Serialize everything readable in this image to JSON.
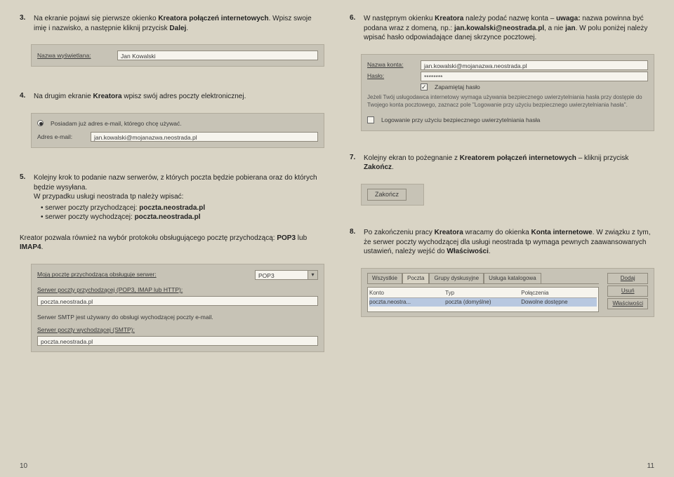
{
  "left": {
    "step3": {
      "num": "3.",
      "text_a": "Na ekranie pojawi się pierwsze okienko ",
      "bold_a": "Kreatora połączeń internetowych",
      "text_b": ". Wpisz swoje imię i nazwisko, a następnie kliknij przycisk ",
      "bold_b": "Dalej",
      "text_c": ".",
      "ss": {
        "lbl": "Nazwa wyświetlana:",
        "val": "Jan Kowalski"
      }
    },
    "step4": {
      "num": "4.",
      "text_a": "Na drugim ekranie ",
      "bold_a": "Kreatora",
      "text_b": " wpisz swój adres poczty elektronicznej.",
      "ss": {
        "radio": "Posiadam już adres e-mail, którego chcę używać.",
        "lbl": "Adres e-mail:",
        "val": "jan.kowalski@mojanazwa.neostrada.pl"
      }
    },
    "step5": {
      "num": "5.",
      "text_a": "Kolejny krok to podanie nazw serwerów, z których poczta będzie pobierana oraz do których będzie wysyłana.",
      "text_b": "W przypadku usługi neostrada tp należy wpisać:",
      "b1": "serwer poczty przychodzącej: ",
      "b1v": "poczta.neostrada.pl",
      "b2": "serwer poczty wychodzącej: ",
      "b2v": "poczta.neostrada.pl",
      "note_a": "Kreator pozwala również na wybór protokołu obsługującego pocztę przychodzącą: ",
      "note_b": "POP3",
      "note_c": " lub ",
      "note_d": "IMAP4",
      "note_e": ".",
      "ss": {
        "l1": "Moją pocztę przychodzącą obsługuje serwer:",
        "sel": "POP3",
        "l2": "Serwer poczty przychodzącej (POP3, IMAP lub HTTP):",
        "v2": "poczta.neostrada.pl",
        "l3": "Serwer SMTP jest używany do obsługi wychodzącej poczty e-mail.",
        "l4": "Serwer poczty wychodzącej (SMTP):",
        "v4": "poczta.neostrada.pl"
      }
    }
  },
  "right": {
    "step6": {
      "num": "6.",
      "text_a": "W następnym okienku ",
      "bold_a": "Kreatora",
      "text_b": " należy podać nazwę konta – ",
      "bold_uw": "uwaga:",
      "text_c": " nazwa powinna być podana wraz z domeną, np.: ",
      "bold_b": "jan.kowalski@neostrada.pl",
      "text_d": ", a nie ",
      "bold_c": "jan",
      "text_e": ". W polu poniżej należy wpisać hasło odpowiadające danej skrzynce pocztowej.",
      "ss": {
        "l1": "Nazwa konta:",
        "v1": "jan.kowalski@mojanazwa.neostrada.pl",
        "l2": "Hasło:",
        "v2": "********",
        "chk": "Zapamiętaj hasło",
        "note": "Jeżeli Twój usługodawca internetowy wymaga używania bezpiecznego uwierzytelniania hasła przy dostępie do Twojego konta pocztowego, zaznacz pole \"Logowanie przy użyciu bezpiecznego uwierzytelniania hasła\".",
        "chk2": "Logowanie przy użyciu bezpiecznego uwierzytelniania hasła"
      }
    },
    "step7": {
      "num": "7.",
      "text_a": "Kolejny ekran to pożegnanie z ",
      "bold_a": "Kreatorem połączeń internetowych",
      "text_b": " – kliknij przycisk ",
      "bold_b": "Zakończ",
      "text_c": ".",
      "ss": {
        "btn": "Zakończ"
      }
    },
    "step8": {
      "num": "8.",
      "text_a": "Po zakończeniu pracy ",
      "bold_a": "Kreatora",
      "text_b": " wracamy do okienka ",
      "bold_b": "Konta internetowe",
      "text_c": ". W związku z tym, że serwer poczty wychodzącej dla usługi neostrada tp wymaga pewnych zaawansowanych ustawień, należy wejść do ",
      "bold_c": "Właściwości",
      "text_d": ".",
      "ss": {
        "tabs": [
          "Wszystkie",
          "Poczta",
          "Grupy dyskusyjne",
          "Usługa katalogowa"
        ],
        "hdr": [
          "Konto",
          "Typ",
          "Połączenia"
        ],
        "row": [
          "poczta.neostra...",
          "poczta (domyślne)",
          "Dowolne dostępne"
        ],
        "btns": [
          "Dodaj",
          "Usuń",
          "Właściwości"
        ]
      }
    }
  },
  "pagenums": {
    "left": "10",
    "right": "11"
  }
}
